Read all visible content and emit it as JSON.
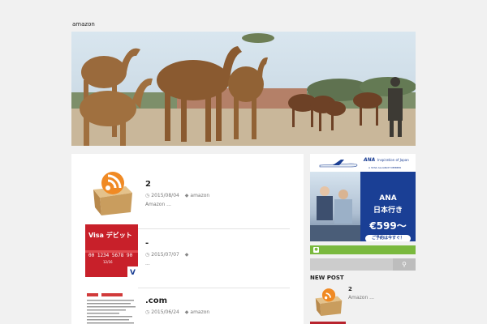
{
  "site": {
    "title": "amazon"
  },
  "posts": [
    {
      "title": "2",
      "date": "2015/08/04",
      "category": "amazon",
      "excerpt": "Amazon  ...",
      "thumb": "rss-box",
      "thumb_text": ""
    },
    {
      "title": "-",
      "date": "2015/07/07",
      "category": "",
      "excerpt": "...",
      "thumb": "visa-debit-card",
      "thumb_text": "Visa デビット"
    },
    {
      "title": ".com",
      "date": "2015/06/24",
      "category": "amazon",
      "excerpt": "",
      "thumb": "document-page",
      "thumb_text": ""
    }
  ],
  "sidebar": {
    "ad": {
      "logo": "ANA",
      "tagline": "Inspiration of Japan",
      "member": "A STAR ALLIANCE MEMBER",
      "headline": "ANA",
      "subhead": "日本行き",
      "price": "€599〜",
      "cta": "ご予約は今すぐ！"
    },
    "new_post_title": "NEW POST",
    "new_post": {
      "title": "2",
      "excerpt": "Amazon  ..."
    }
  },
  "colors": {
    "accent_green": "#7ab93e",
    "ad_blue": "#1a3f95",
    "card_red": "#c8202a"
  }
}
